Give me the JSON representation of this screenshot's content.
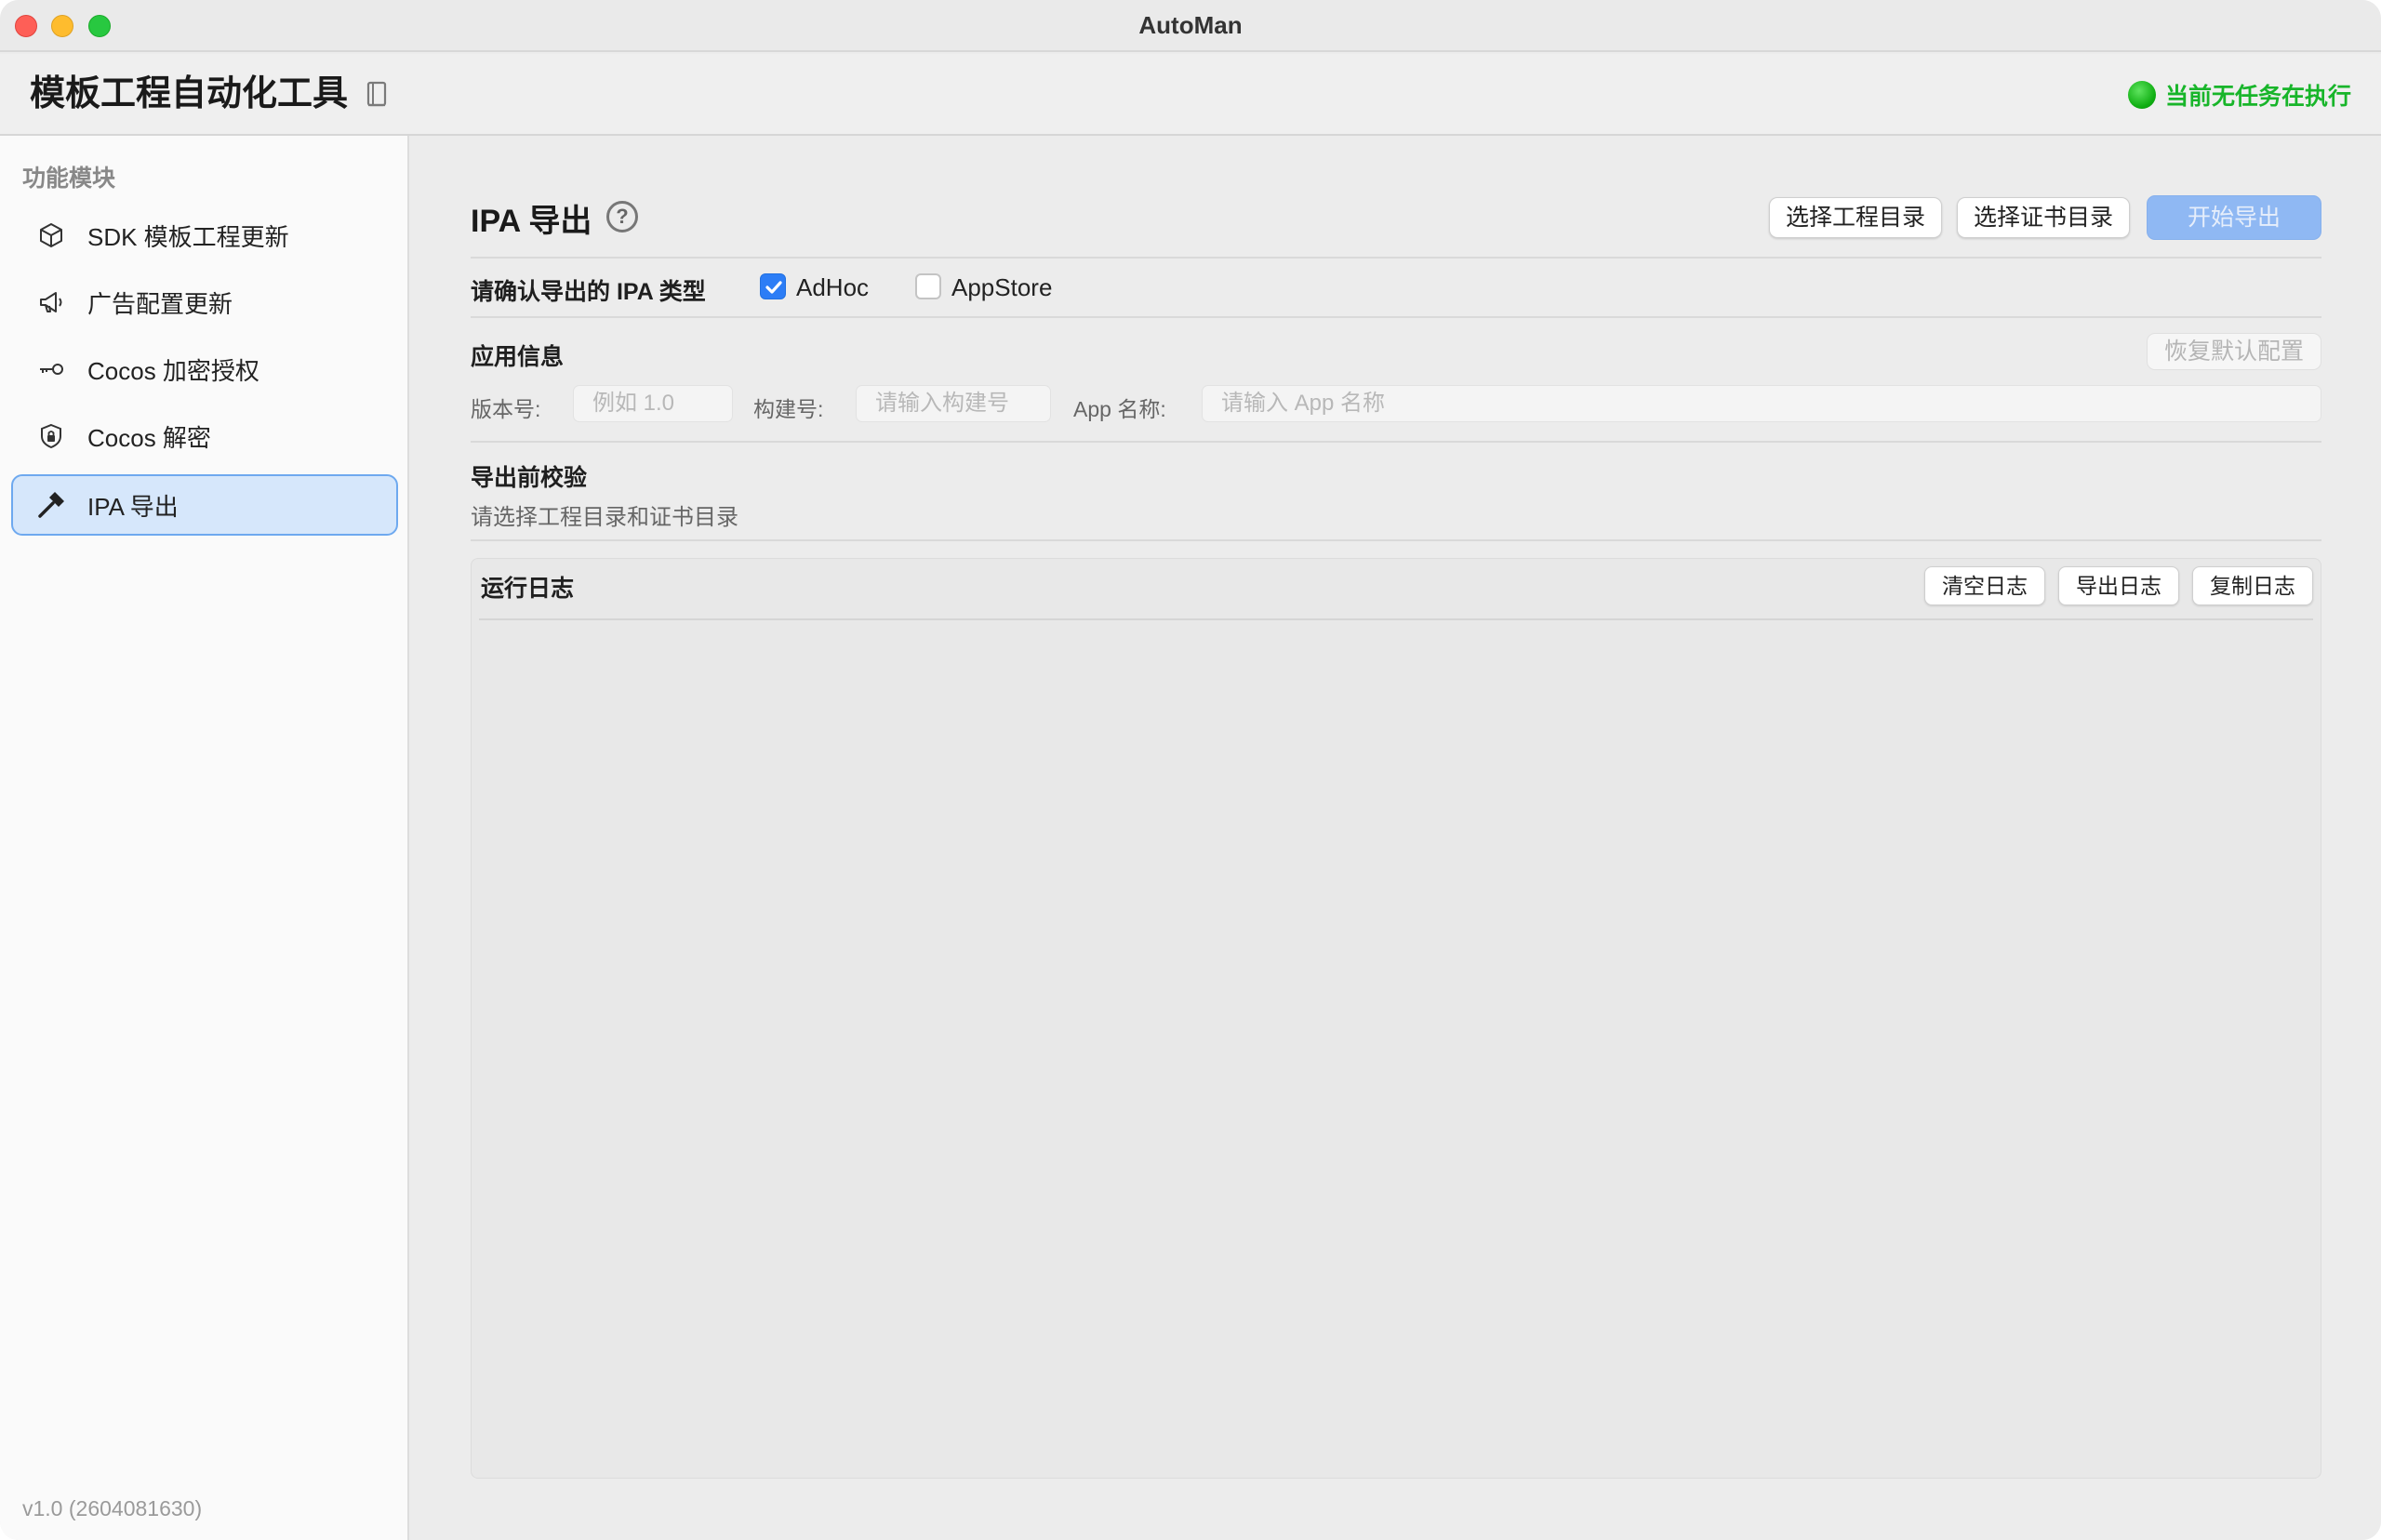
{
  "window": {
    "title": "AutoMan"
  },
  "header": {
    "app_title": "模板工程自动化工具",
    "status_text": "当前无任务在执行",
    "status_color": "#18b52a"
  },
  "sidebar": {
    "heading": "功能模块",
    "items": [
      {
        "label": "SDK 模板工程更新",
        "icon": "cube-icon"
      },
      {
        "label": "广告配置更新",
        "icon": "megaphone-icon"
      },
      {
        "label": "Cocos 加密授权",
        "icon": "key-icon"
      },
      {
        "label": "Cocos 解密",
        "icon": "lock-shield-icon"
      },
      {
        "label": "IPA 导出",
        "icon": "hammer-icon",
        "active": true
      }
    ],
    "version": "v1.0 (2604081630)"
  },
  "main": {
    "title": "IPA 导出",
    "buttons": {
      "select_project": "选择工程目录",
      "select_cert": "选择证书目录",
      "start_export": "开始导出"
    },
    "ipa_type": {
      "label": "请确认导出的 IPA 类型",
      "options": [
        {
          "label": "AdHoc",
          "checked": true
        },
        {
          "label": "AppStore",
          "checked": false
        }
      ]
    },
    "app_info": {
      "heading": "应用信息",
      "reset_button": "恢复默认配置",
      "version_label": "版本号:",
      "version_placeholder": "例如 1.0",
      "build_label": "构建号:",
      "build_placeholder": "请输入构建号",
      "name_label": "App 名称:",
      "name_placeholder": "请输入 App 名称"
    },
    "precheck": {
      "heading": "导出前校验",
      "hint": "请选择工程目录和证书目录"
    },
    "log": {
      "title": "运行日志",
      "clear": "清空日志",
      "export": "导出日志",
      "copy": "复制日志"
    }
  },
  "colors": {
    "accent": "#2c7df6",
    "active_item_bg": "#d6e7fb"
  }
}
